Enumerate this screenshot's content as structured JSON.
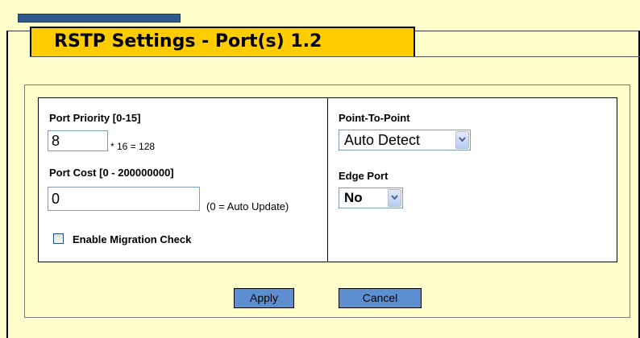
{
  "title": "RSTP Settings - Port(s) 1.2",
  "port_priority": {
    "label": "Port Priority [0-15]",
    "value": "8",
    "note": "* 16 = 128"
  },
  "port_cost": {
    "label": "Port Cost [0 - 200000000]",
    "value": "0",
    "note": "(0 = Auto Update)"
  },
  "migration_check": {
    "label": "Enable Migration Check",
    "checked": false
  },
  "point_to_point": {
    "label": "Point-To-Point",
    "selected": "Auto Detect"
  },
  "edge_port": {
    "label": "Edge Port",
    "selected": "No"
  },
  "buttons": {
    "apply": "Apply",
    "cancel": "Cancel"
  },
  "colors": {
    "background": "#ffffcc",
    "title_tab": "#ffcc00",
    "title_bar_top": "#2f5a8c",
    "button": "#5d8fd0"
  },
  "icons": {
    "select_arrow": "chevron-down-icon"
  }
}
